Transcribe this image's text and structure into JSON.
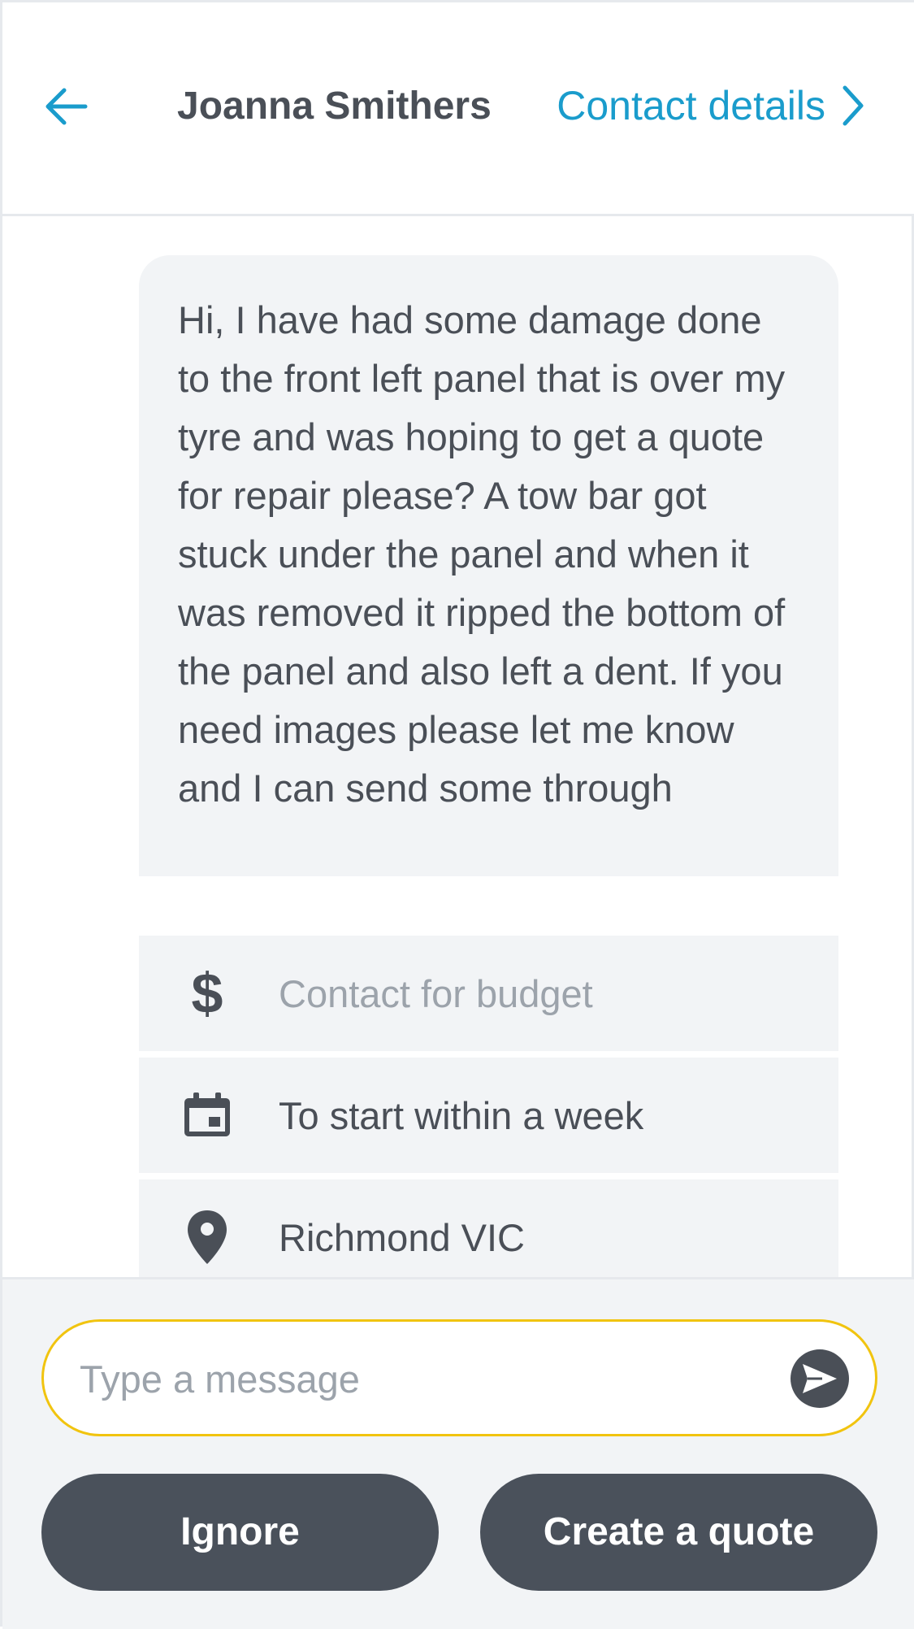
{
  "header": {
    "back_icon": "arrow-left-icon",
    "title": "Joanna Smithers",
    "contact_link_label": "Contact details",
    "contact_link_icon": "chevron-right-icon",
    "accent_color": "#1a9ccc"
  },
  "message": {
    "text": "Hi, I have had some damage done to the front left panel that is over my tyre and was hoping to get a quote for repair please? A tow bar got stuck under the panel and when it was removed it ripped the bottom of the panel and also left a dent. If you need images please let me know and I can send some through"
  },
  "details": {
    "budget": {
      "icon": "dollar-icon",
      "symbol": "$",
      "label": "Contact for budget"
    },
    "timing": {
      "icon": "calendar-icon",
      "label": "To start within a week"
    },
    "location": {
      "icon": "location-pin-icon",
      "label": "Richmond VIC"
    }
  },
  "composer": {
    "placeholder": "Type a message",
    "send_icon": "send-icon",
    "border_color": "#f1c40f"
  },
  "actions": {
    "ignore_label": "Ignore",
    "create_quote_label": "Create a quote"
  }
}
